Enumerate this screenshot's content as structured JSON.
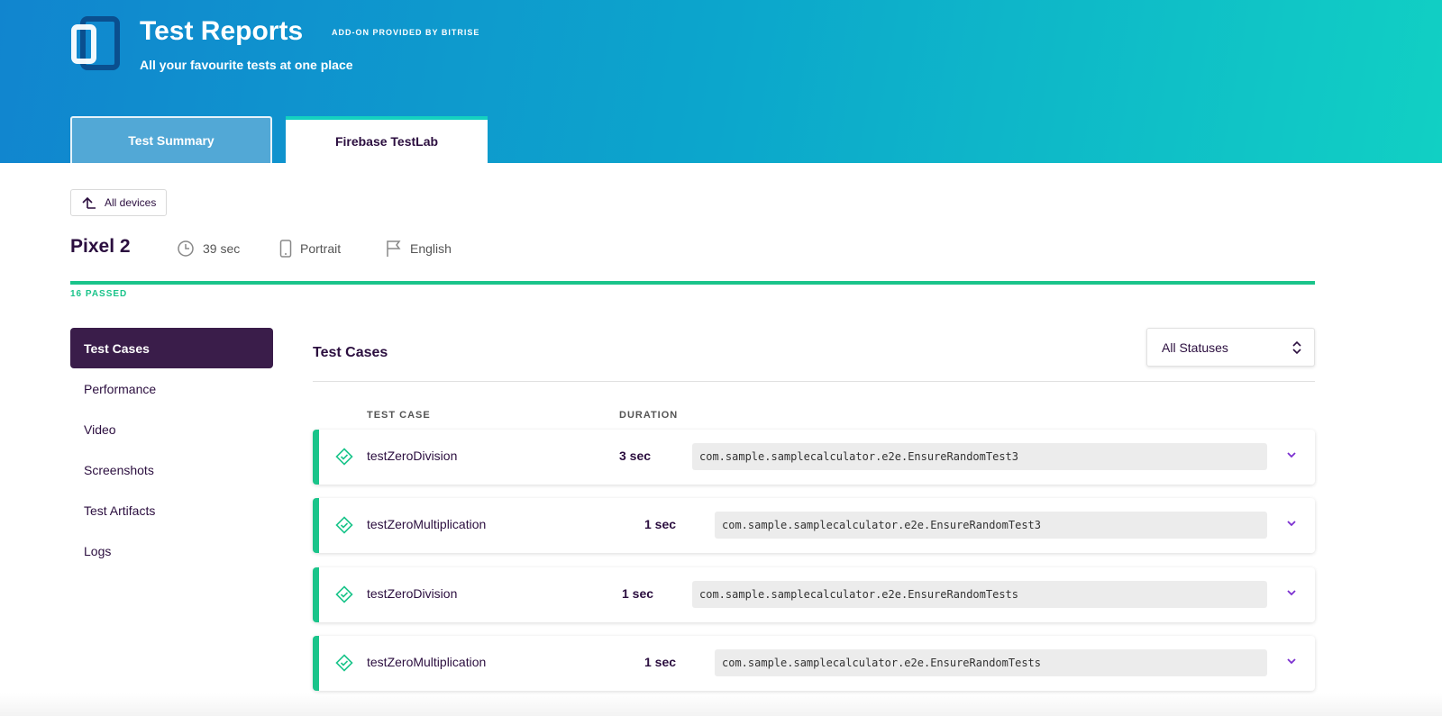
{
  "header": {
    "title": "Test Reports",
    "addon": "ADD-ON PROVIDED BY BITRISE",
    "subtitle": "All your favourite tests at one place"
  },
  "tabs": [
    {
      "label": "Test Summary",
      "active": false
    },
    {
      "label": "Firebase TestLab",
      "active": true
    }
  ],
  "back_button": "All devices",
  "device": {
    "name": "Pixel 2",
    "duration": "39 sec",
    "orientation": "Portrait",
    "locale": "English"
  },
  "status": {
    "passed_label": "16 PASSED",
    "color": "#1ac48a"
  },
  "sidebar": {
    "items": [
      {
        "label": "Test Cases"
      },
      {
        "label": "Performance"
      },
      {
        "label": "Video"
      },
      {
        "label": "Screenshots"
      },
      {
        "label": "Test Artifacts"
      },
      {
        "label": "Logs"
      }
    ]
  },
  "main": {
    "title": "Test Cases",
    "filter": "All Statuses",
    "columns": [
      "TEST CASE",
      "DURATION"
    ],
    "rows": [
      {
        "name": "testZeroDivision",
        "duration": "3 sec",
        "class": "com.sample.samplecalculator.e2e.EnsureRandomTest3"
      },
      {
        "name": "testZeroMultiplication",
        "duration": "1 sec",
        "class": "com.sample.samplecalculator.e2e.EnsureRandomTest3"
      },
      {
        "name": "testZeroDivision",
        "duration": "1 sec",
        "class": "com.sample.samplecalculator.e2e.EnsureRandomTests"
      },
      {
        "name": "testZeroMultiplication",
        "duration": "1 sec",
        "class": "com.sample.samplecalculator.e2e.EnsureRandomTests"
      }
    ]
  }
}
